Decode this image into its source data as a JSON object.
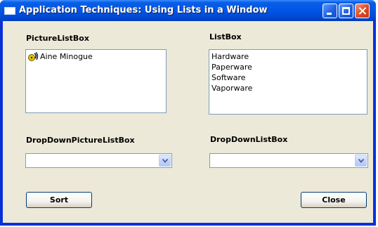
{
  "window": {
    "title": "Application Techniques: Using Lists in a Window"
  },
  "picture_listbox": {
    "label": "PictureListBox",
    "items": [
      {
        "text": "Aine Minogue",
        "icon": "sound-cd-icon"
      }
    ]
  },
  "listbox": {
    "label": "ListBox",
    "items": [
      "Hardware",
      "Paperware",
      "Software",
      "Vaporware"
    ]
  },
  "dropdown_picture_listbox": {
    "label": "DropDownPictureListBox",
    "value": ""
  },
  "dropdown_listbox": {
    "label": "DropDownListBox",
    "value": ""
  },
  "buttons": {
    "sort": "Sort",
    "close": "Close"
  },
  "colors": {
    "titlebar": "#0055e5",
    "client_background": "#ece9d8",
    "field_border": "#7f9db9"
  }
}
